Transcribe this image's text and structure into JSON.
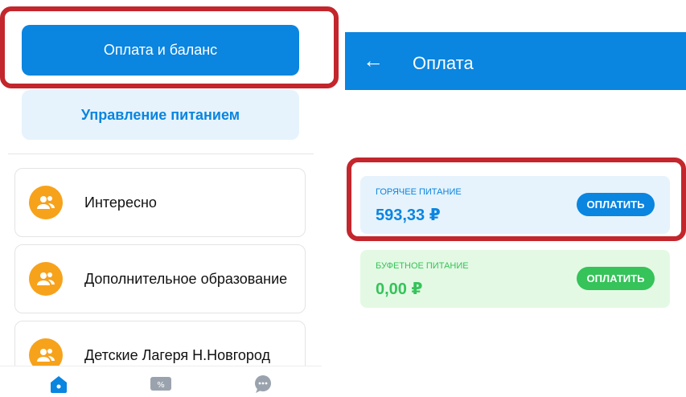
{
  "left": {
    "primary_button": "Оплата и баланс",
    "secondary_button": "Управление питанием",
    "sections": [
      {
        "label": "Интересно",
        "icon": "people-icon"
      },
      {
        "label": "Дополнительное образование",
        "icon": "people-icon"
      },
      {
        "label": "Детские Лагеря Н.Новгород",
        "icon": "people-icon"
      }
    ],
    "nav": [
      "home-icon",
      "ticket-icon",
      "chat-icon"
    ]
  },
  "right": {
    "title": "Оплата",
    "cards": [
      {
        "caption": "ГОРЯЧЕЕ ПИТАНИЕ",
        "amount": "593,33 ₽",
        "button": "ОПЛАТИТЬ",
        "accent": "#0a85e0",
        "bg": "#e6f3fc"
      },
      {
        "caption": "БУФЕТНОЕ ПИТАНИЕ",
        "amount": "0,00 ₽",
        "button": "ОПЛАТИТЬ",
        "accent": "#35c35a",
        "bg": "#e4f9e4"
      }
    ]
  },
  "colors": {
    "primary": "#0a85e0",
    "highlight": "#c3262c",
    "orange": "#f7a21b",
    "green": "#35c35a"
  }
}
